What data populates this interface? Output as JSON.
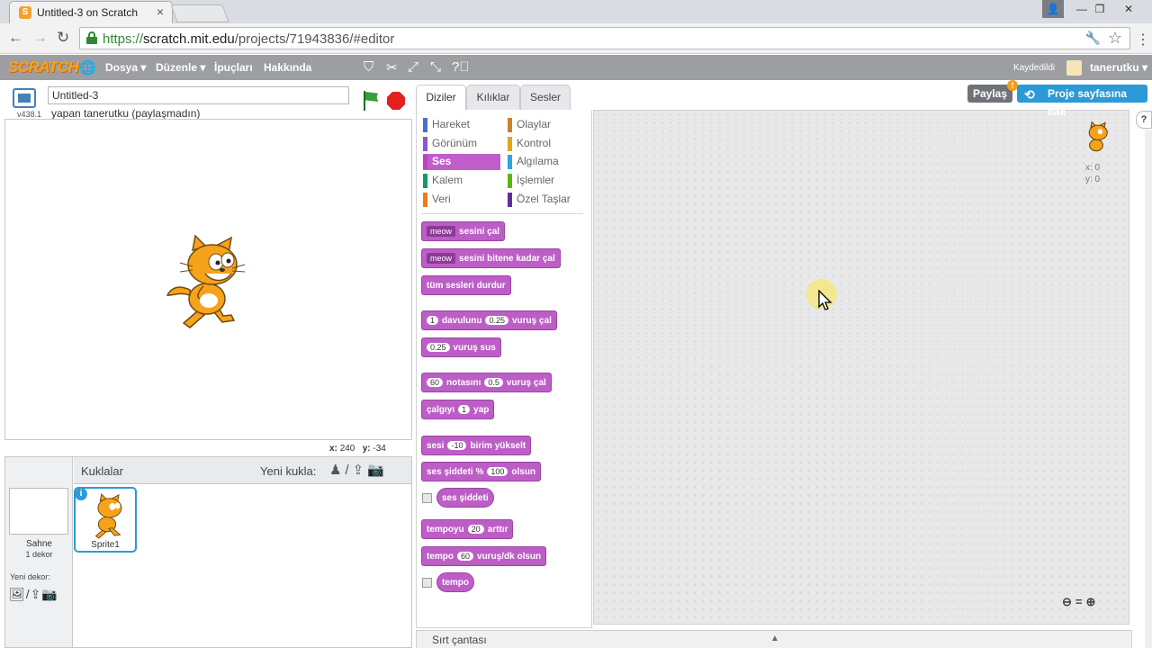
{
  "browser": {
    "tab_title": "Untitled-3 on Scratch",
    "url_scheme": "https://",
    "url_host": "scratch.mit.edu",
    "url_path": "/projects/71943836/#editor"
  },
  "topbar": {
    "logo": "SCRATCH",
    "menu": [
      "Dosya ▾",
      "Düzenle ▾",
      "İpuçları",
      "Hakkında"
    ],
    "saved_label": "Kaydedildi",
    "username": "tanerutku ▾"
  },
  "stage": {
    "version": "v438.1",
    "title_value": "Untitled-3",
    "byline": "yapan tanerutku (paylaşmadın)",
    "x_label": "x:",
    "x_value": "240",
    "y_label": "y:",
    "y_value": "-34"
  },
  "sprites": {
    "header": "Kuklalar",
    "new_sprite": "Yeni kukla:",
    "stage_name": "Sahne",
    "stage_sub": "1 dekor",
    "new_backdrop": "Yeni dekor:",
    "sprite_name": "Sprite1",
    "info": "i"
  },
  "tabs": [
    "Diziler",
    "Kılıklar",
    "Sesler"
  ],
  "categories": [
    {
      "label": "Hareket",
      "color": "#4a6cd4"
    },
    {
      "label": "Görünüm",
      "color": "#8a55d7"
    },
    {
      "label": "Ses",
      "color": "#bb42c3"
    },
    {
      "label": "Kalem",
      "color": "#0e9a6c"
    },
    {
      "label": "Veri",
      "color": "#ee7d16"
    },
    {
      "label": "Olaylar",
      "color": "#c88330"
    },
    {
      "label": "Kontrol",
      "color": "#e1a91a"
    },
    {
      "label": "Algılama",
      "color": "#2ca5e2"
    },
    {
      "label": "İşlemler",
      "color": "#5cb712"
    },
    {
      "label": "Özel Taşlar",
      "color": "#632d99"
    }
  ],
  "blocks": {
    "b1": {
      "dd": "meow",
      "text": "sesini çal"
    },
    "b2": {
      "dd": "meow",
      "text": "sesini bitene kadar çal"
    },
    "b3": {
      "text": "tüm sesleri durdur"
    },
    "b4": {
      "dd": "1",
      "a": "davulunu",
      "num": "0.25",
      "b": "vuruş çal"
    },
    "b5": {
      "num": "0.25",
      "text": "vuruş sus"
    },
    "b6": {
      "dd": "60",
      "a": "notasını",
      "num": "0.5",
      "b": "vuruş çal"
    },
    "b7": {
      "a": "çalgıyı",
      "dd": "1",
      "b": "yap"
    },
    "b8": {
      "a": "sesi",
      "num": "-10",
      "b": "birim yükselt"
    },
    "b9": {
      "a": "ses şiddeti %",
      "num": "100",
      "b": "olsun"
    },
    "b10": {
      "text": "ses şiddeti"
    },
    "b11": {
      "a": "tempoyu",
      "num": "20",
      "b": "arttır"
    },
    "b12": {
      "a": "tempo",
      "num": "60",
      "b": "vuruş/dk olsun"
    },
    "b13": {
      "text": "tempo"
    }
  },
  "scripts": {
    "x_label": "x: 0",
    "y_label": "y: 0"
  },
  "buttons": {
    "share": "Paylaş",
    "share_badge": "!",
    "see_project": "Proje sayfasına bak",
    "help": "?"
  },
  "backpack": {
    "label": "Sırt çantası"
  },
  "colors": {
    "sound_block": "#bd5ec7",
    "topbar": "#9c9ea2",
    "accent_blue": "#2b9ad6"
  }
}
